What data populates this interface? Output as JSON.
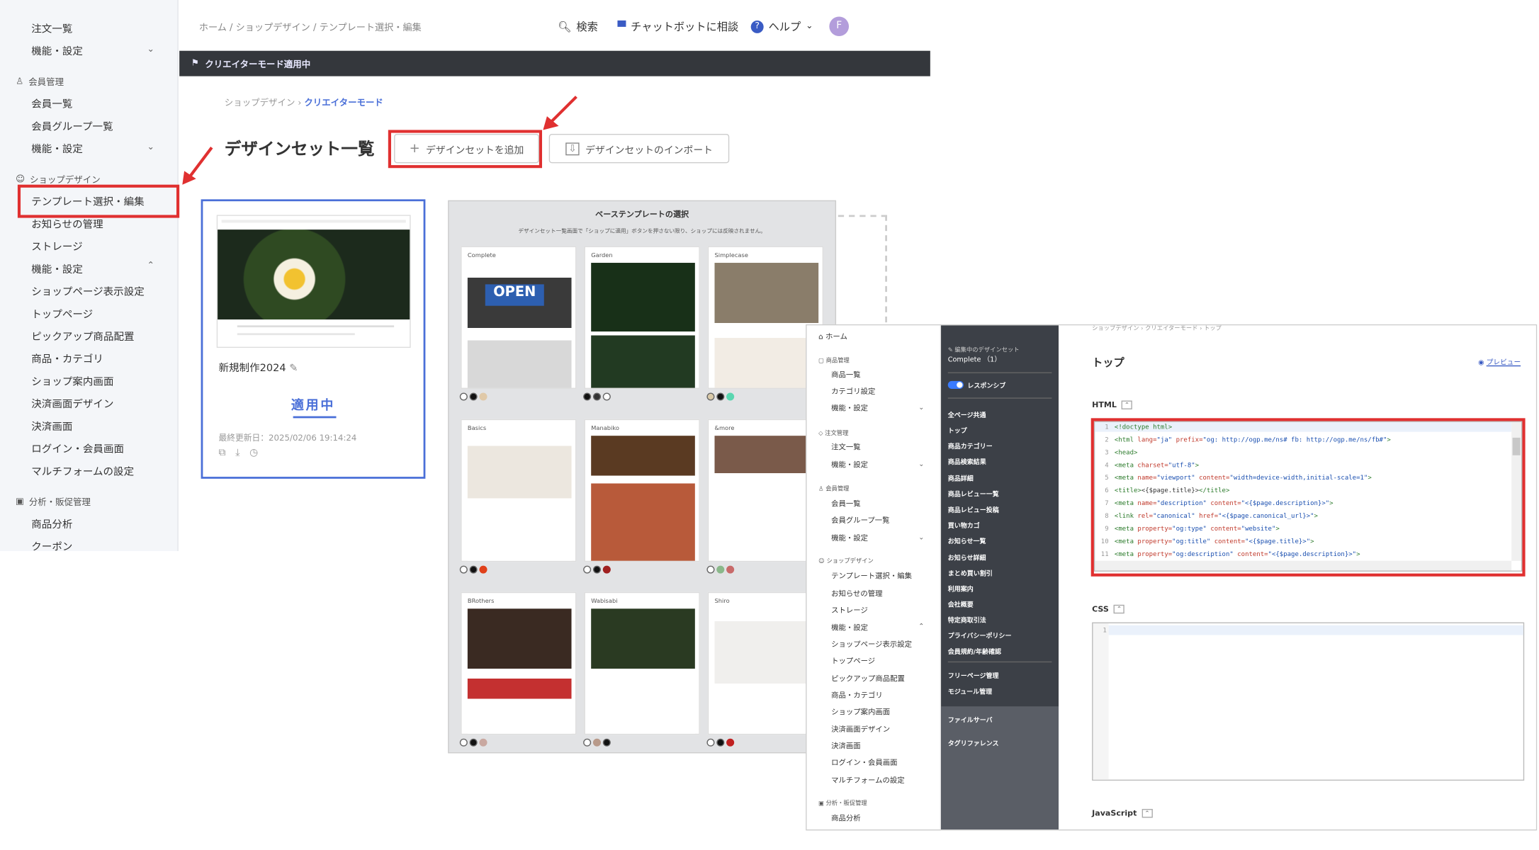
{
  "sidebar": {
    "items_top": [
      "注文一覧",
      "機能・設定"
    ],
    "section_member": "会員管理",
    "member_items": [
      "会員一覧",
      "会員グループ一覧",
      "機能・設定"
    ],
    "section_shop": "ショップデザイン",
    "shop_items": [
      "テンプレート選択・編集",
      "お知らせの管理",
      "ストレージ",
      "機能・設定",
      "ショップページ表示設定",
      "トップページ",
      "ピックアップ商品配置",
      "商品・カテゴリ",
      "ショップ案内画面",
      "決済画面デザイン",
      "決済画面",
      "ログイン・会員画面",
      "マルチフォームの設定"
    ],
    "section_analytics": "分析・販促管理",
    "analytics_items": [
      "商品分析",
      "クーポン"
    ]
  },
  "header": {
    "breadcrumb": "ホーム / ショップデザイン / テンプレート選択・編集",
    "search": "検索",
    "chatbot": "チャットボットに相談",
    "help": "ヘルプ",
    "avatar": "F"
  },
  "banner": "クリエイターモード適用中",
  "breadcrumb2": {
    "parent": "ショップデザイン",
    "current": "クリエイターモード"
  },
  "page_title": "デザインセット一覧",
  "buttons": {
    "add": "デザインセットを追加",
    "import": "デザインセットのインポート"
  },
  "design_card": {
    "name": "新規制作2024",
    "status": "適用中",
    "updated": "最終更新日：2025/02/06 19:14:24"
  },
  "template_panel": {
    "title": "ベーステンプレートの選択",
    "subtitle": "デザインセット一覧画面で「ショップに適用」ボタンを押さない限り、ショップには反映されません。",
    "templates": [
      "Complete",
      "Garden",
      "Simplecase",
      "Basics",
      "Manabiko",
      "&more",
      "BRothers",
      "Wabisabi",
      "Shiro"
    ]
  },
  "editor": {
    "nav_home": "ホーム",
    "nav_sec1": "商品管理",
    "nav_sec1_items": [
      "商品一覧",
      "カテゴリ設定",
      "機能・設定"
    ],
    "nav_sec2": "注文管理",
    "nav_sec2_items": [
      "注文一覧",
      "機能・設定"
    ],
    "nav_sec3": "会員管理",
    "nav_sec3_items": [
      "会員一覧",
      "会員グループ一覧",
      "機能・設定"
    ],
    "nav_sec4": "ショップデザイン",
    "nav_sec4_items": [
      "テンプレート選択・編集",
      "お知らせの管理",
      "ストレージ",
      "機能・設定",
      "ショップページ表示設定",
      "トップページ",
      "ピックアップ商品配置",
      "商品・カテゴリ",
      "ショップ案内画面",
      "決済画面デザイン",
      "決済画面",
      "ログイン・会員画面",
      "マルチフォームの設定"
    ],
    "nav_sec5": "分析・販促管理",
    "nav_sec5_items": [
      "商品分析"
    ],
    "editing_label": "編集中のデザインセット",
    "editing_name": "Complete （1）",
    "responsive": "レスポンシブ",
    "pages": [
      "全ページ共通",
      "トップ",
      "商品カテゴリー",
      "商品検索結果",
      "商品詳細",
      "商品レビュー一覧",
      "商品レビュー投稿",
      "買い物カゴ",
      "お知らせ一覧",
      "お知らせ詳細",
      "まとめ買い割引",
      "利用案内",
      "会社概要",
      "特定商取引法",
      "プライバシーポリシー",
      "会員規約/年齢確認"
    ],
    "pages2": [
      "フリーページ管理",
      "モジュール管理"
    ],
    "pages3": [
      "ファイルサーバ",
      "タグリファレンス"
    ],
    "breadcrumb": "ショップデザイン › クリエイターモード › トップ",
    "title": "トップ",
    "preview": "プレビュー",
    "html_label": "HTML",
    "css_label": "CSS",
    "js_label": "JavaScript"
  }
}
